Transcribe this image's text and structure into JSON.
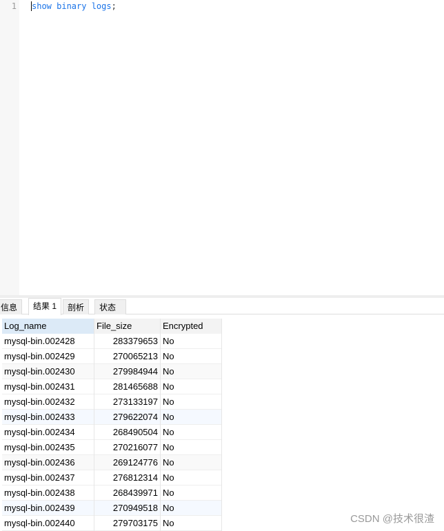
{
  "editor": {
    "line_number": "1",
    "code": "show binary logs",
    "code_end": ";"
  },
  "tabs": [
    "信息",
    "结果 1",
    "剖析",
    "状态"
  ],
  "table": {
    "columns": [
      "Log_name",
      "File_size",
      "Encrypted"
    ],
    "rows": [
      [
        "mysql-bin.002428",
        "283379653",
        "No"
      ],
      [
        "mysql-bin.002429",
        "270065213",
        "No"
      ],
      [
        "mysql-bin.002430",
        "279984944",
        "No"
      ],
      [
        "mysql-bin.002431",
        "281465688",
        "No"
      ],
      [
        "mysql-bin.002432",
        "273133197",
        "No"
      ],
      [
        "mysql-bin.002433",
        "279622074",
        "No"
      ],
      [
        "mysql-bin.002434",
        "268490504",
        "No"
      ],
      [
        "mysql-bin.002435",
        "270216077",
        "No"
      ],
      [
        "mysql-bin.002436",
        "269124776",
        "No"
      ],
      [
        "mysql-bin.002437",
        "276812314",
        "No"
      ],
      [
        "mysql-bin.002438",
        "268439971",
        "No"
      ],
      [
        "mysql-bin.002439",
        "270949518",
        "No"
      ],
      [
        "mysql-bin.002440",
        "279703175",
        "No"
      ]
    ]
  },
  "watermark": "CSDN @技术很渣"
}
